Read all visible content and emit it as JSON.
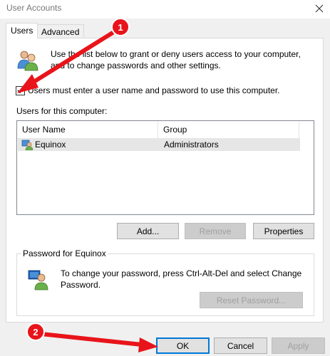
{
  "window": {
    "title": "User Accounts",
    "close_icon": "close-icon"
  },
  "tabs": [
    {
      "label": "Users",
      "active": true
    },
    {
      "label": "Advanced",
      "active": false
    }
  ],
  "users_tab": {
    "intro": "Use the list below to grant or deny users access to your computer, and to change passwords and other settings.",
    "require_login_checkbox": {
      "label": "Users must enter a user name and password to use this computer.",
      "checked": true
    },
    "users_list_label": "Users for this computer:",
    "columns": [
      "User Name",
      "Group"
    ],
    "rows": [
      {
        "user_name": "Equinox",
        "group": "Administrators",
        "selected": true
      }
    ],
    "buttons": {
      "add": "Add...",
      "remove": "Remove",
      "properties": "Properties"
    },
    "password_group": {
      "legend": "Password for Equinox",
      "text": "To change your password, press Ctrl-Alt-Del and select Change Password.",
      "reset_button": "Reset Password..."
    }
  },
  "footer_buttons": {
    "ok": "OK",
    "cancel": "Cancel",
    "apply": "Apply"
  },
  "annotations": {
    "marker1": "1",
    "marker2": "2",
    "color": "#e8141a"
  }
}
